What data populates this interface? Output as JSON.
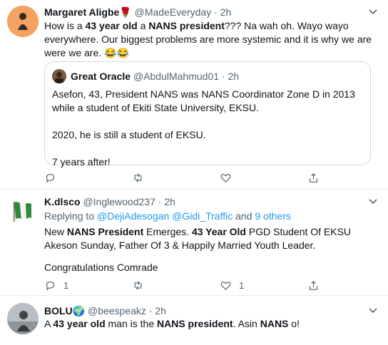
{
  "tweets": [
    {
      "name": "Margaret Aligbe🌹",
      "handle": "@MadeEveryday",
      "dot": "·",
      "time": "2h",
      "text_parts": [
        "How is a ",
        "43 year old",
        " a ",
        "NANS president",
        "???  Na wah oh. Wayo wayo everywhere. Our biggest problems are more systemic and it is why we are were we are.  😂😂"
      ],
      "quote": {
        "name": "Great Oracle",
        "handle": "@AbdulMahmud01",
        "dot": "·",
        "time": "2h",
        "lines": [
          "Asefon, 43, President NANS was NANS Coordinator Zone D in 2013 while a student of Ekiti State University, EKSU.",
          "2020, he is still a student of EKSU.",
          "7 years after!"
        ]
      },
      "reply_count": "",
      "retweet_count": "",
      "like_count": ""
    },
    {
      "name": "K.dlsco",
      "handle": "@Inglewood237",
      "dot": "·",
      "time": "2h",
      "replying_prefix": "Replying to ",
      "replying_users": "@DejiAdesogan @Gidi_Traffic",
      "replying_and": " and ",
      "replying_others": "9 others",
      "text_parts": [
        "New ",
        "NANS President",
        " Emerges. ",
        "43 Year Old",
        " PGD Student Of EKSU Akeson Sunday, Father Of 3 & Happily Married Youth Leader."
      ],
      "text2": "Congratulations Comrade",
      "reply_count": "1",
      "retweet_count": "",
      "like_count": "1"
    },
    {
      "name": "BOLU🌍",
      "handle": "@beespeakz",
      "dot": "·",
      "time": "2h",
      "text_parts": [
        "A ",
        "43 year old",
        " man is the ",
        "NANS president",
        ". Asin ",
        "NANS",
        " o!"
      ]
    }
  ],
  "icons": {
    "caret": "chevron-down-icon",
    "reply": "reply-icon",
    "retweet": "retweet-icon",
    "like": "heart-icon",
    "share": "share-icon"
  },
  "colors": {
    "link": "#1d9bf0",
    "secondary": "#536471",
    "divider": "#e6ecf0"
  }
}
